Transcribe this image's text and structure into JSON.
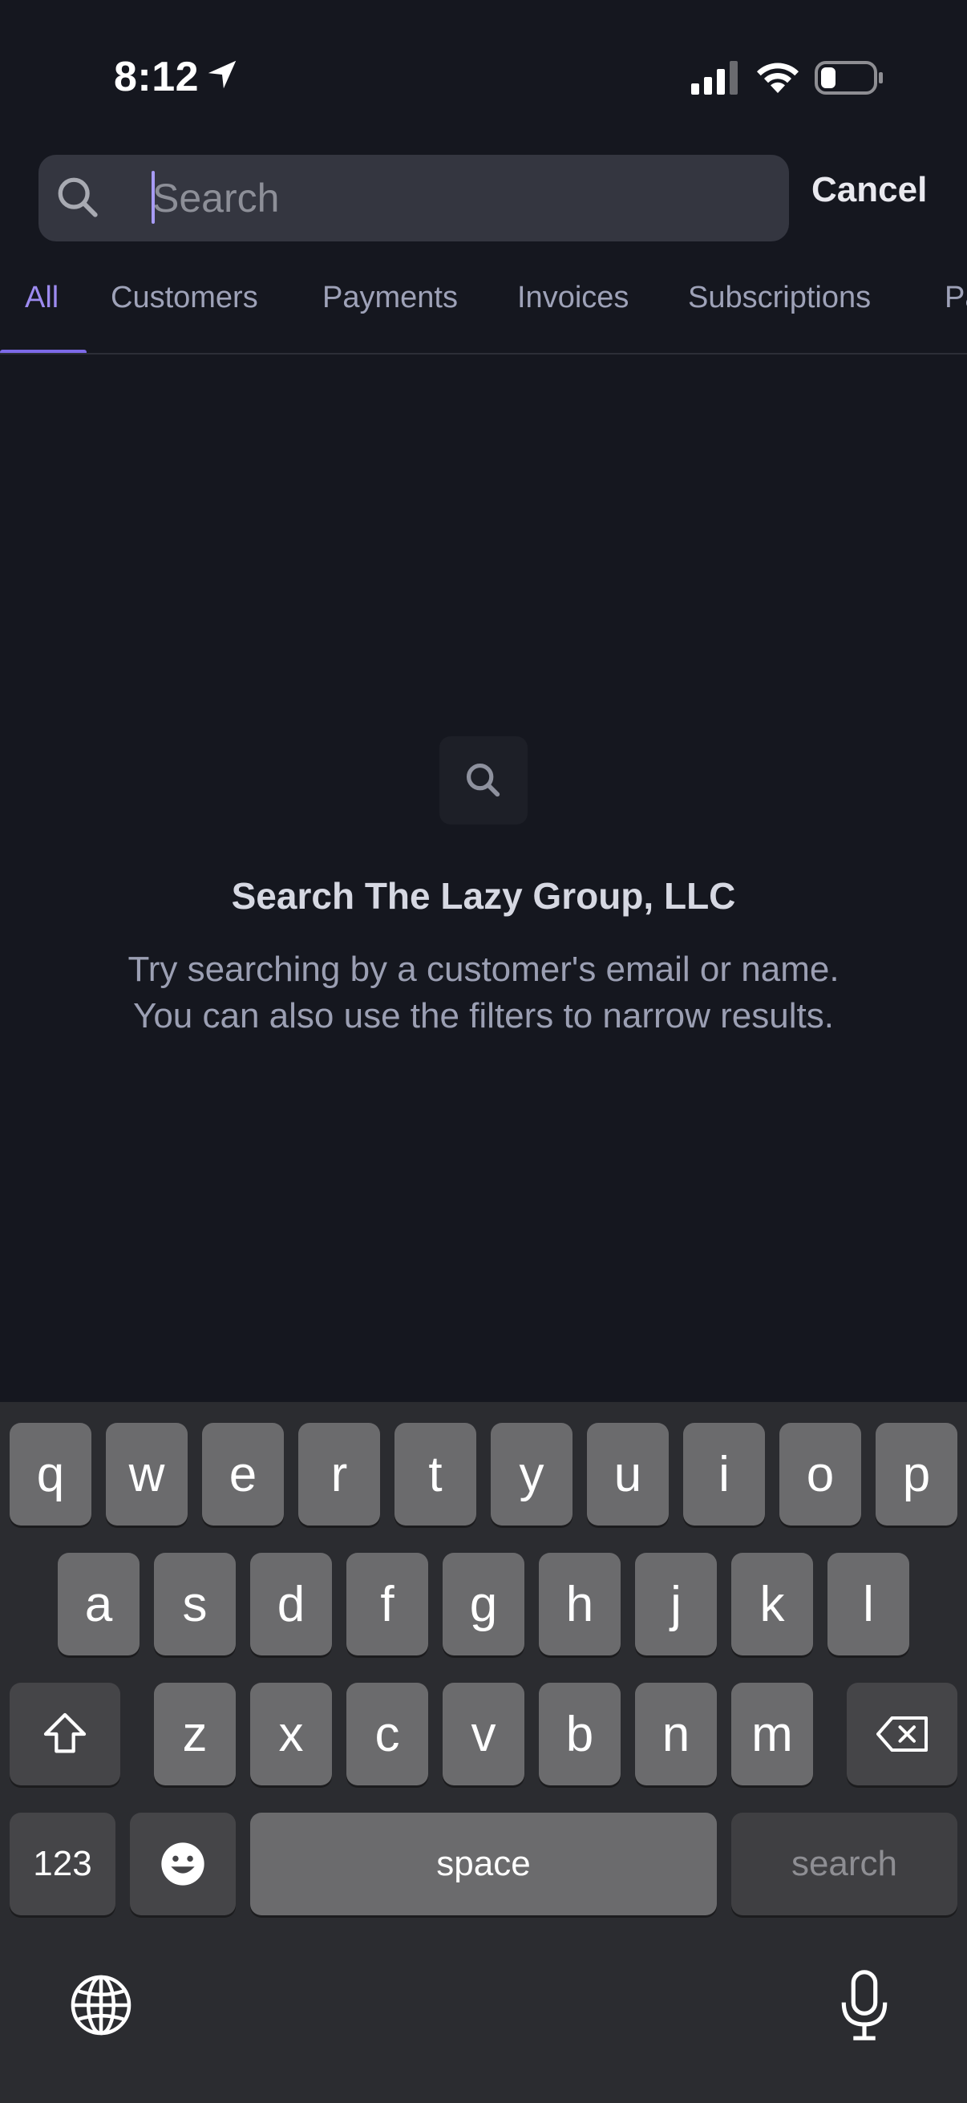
{
  "status_bar": {
    "time": "8:12"
  },
  "search": {
    "placeholder": "Search",
    "cancel_label": "Cancel"
  },
  "tabs": [
    {
      "label": "All",
      "active": true
    },
    {
      "label": "Customers",
      "active": false
    },
    {
      "label": "Payments",
      "active": false
    },
    {
      "label": "Invoices",
      "active": false
    },
    {
      "label": "Subscriptions",
      "active": false
    },
    {
      "label": "Pa",
      "active": false
    }
  ],
  "empty_state": {
    "icon": "search-icon",
    "title": "Search The Lazy Group, LLC",
    "line1": "Try searching by a customer's email or name.",
    "line2": "You can also use the filters to narrow results."
  },
  "keyboard": {
    "row1": [
      "q",
      "w",
      "e",
      "r",
      "t",
      "y",
      "u",
      "i",
      "o",
      "p"
    ],
    "row2": [
      "a",
      "s",
      "d",
      "f",
      "g",
      "h",
      "j",
      "k",
      "l"
    ],
    "row3": [
      "z",
      "x",
      "c",
      "v",
      "b",
      "n",
      "m"
    ],
    "numbers_label": "123",
    "space_label": "space",
    "return_label": "search"
  },
  "colors": {
    "background": "#15171f",
    "accent": "#7d6ae8",
    "tab_inactive": "#9ea2b8"
  }
}
